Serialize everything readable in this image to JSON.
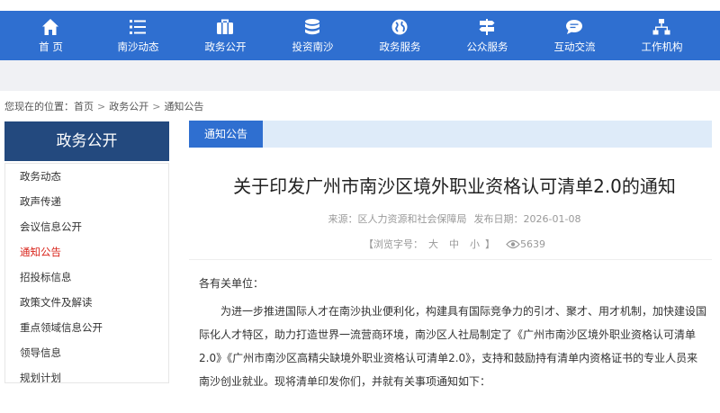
{
  "nav": {
    "items": [
      {
        "label": "首 页",
        "icon": "home-icon"
      },
      {
        "label": "南沙动态",
        "icon": "list-icon"
      },
      {
        "label": "政务公开",
        "icon": "briefcase-icon"
      },
      {
        "label": "投资南沙",
        "icon": "database-icon"
      },
      {
        "label": "政务服务",
        "icon": "globe-icon"
      },
      {
        "label": "公众服务",
        "icon": "signpost-icon"
      },
      {
        "label": "互动交流",
        "icon": "chat-icon"
      },
      {
        "label": "工作机构",
        "icon": "org-chart-icon"
      }
    ]
  },
  "breadcrumb": {
    "prefix": "您现在的位置：",
    "items": [
      "首页",
      "政务公开",
      "通知公告"
    ],
    "separator": ">"
  },
  "sidebar": {
    "title": "政务公开",
    "items": [
      {
        "label": "政务动态"
      },
      {
        "label": "政声传递"
      },
      {
        "label": "会议信息公开"
      },
      {
        "label": "通知公告",
        "active": true
      },
      {
        "label": "招投标信息"
      },
      {
        "label": "政策文件及解读"
      },
      {
        "label": "重点领域信息公开"
      },
      {
        "label": "领导信息"
      },
      {
        "label": "规划计划"
      }
    ]
  },
  "content": {
    "tab_label": "通知公告",
    "title": "关于印发广州市南沙区境外职业资格认可清单2.0的通知",
    "source_label": "来源：",
    "source": "区人力资源和社会保障局",
    "date_label": "发布日期：",
    "date": "2026-01-08",
    "font_label": "【浏览字号：",
    "font_large": "大",
    "font_medium": "中",
    "font_small": "小",
    "font_close": "】",
    "views": "5639",
    "greeting": "各有关单位：",
    "paragraph": "为进一步推进国际人才在南沙执业便利化，构建具有国际竞争力的引才、聚才、用才机制，加快建设国际化人才特区，助力打造世界一流营商环境，南沙区人社局制定了《广州市南沙区境外职业资格认可清单2.0》《广州市南沙区高精尖缺境外职业资格认可清单2.0》，支持和鼓励持有清单内资格证书的专业人员来南沙创业就业。现将清单印发你们，并就有关事项通知如下："
  },
  "colors": {
    "nav_bg": "#2f6fd0",
    "sidebar_title_bg": "#23497e",
    "active_item": "#d9251c",
    "tabbar_bg": "#deebf9"
  }
}
